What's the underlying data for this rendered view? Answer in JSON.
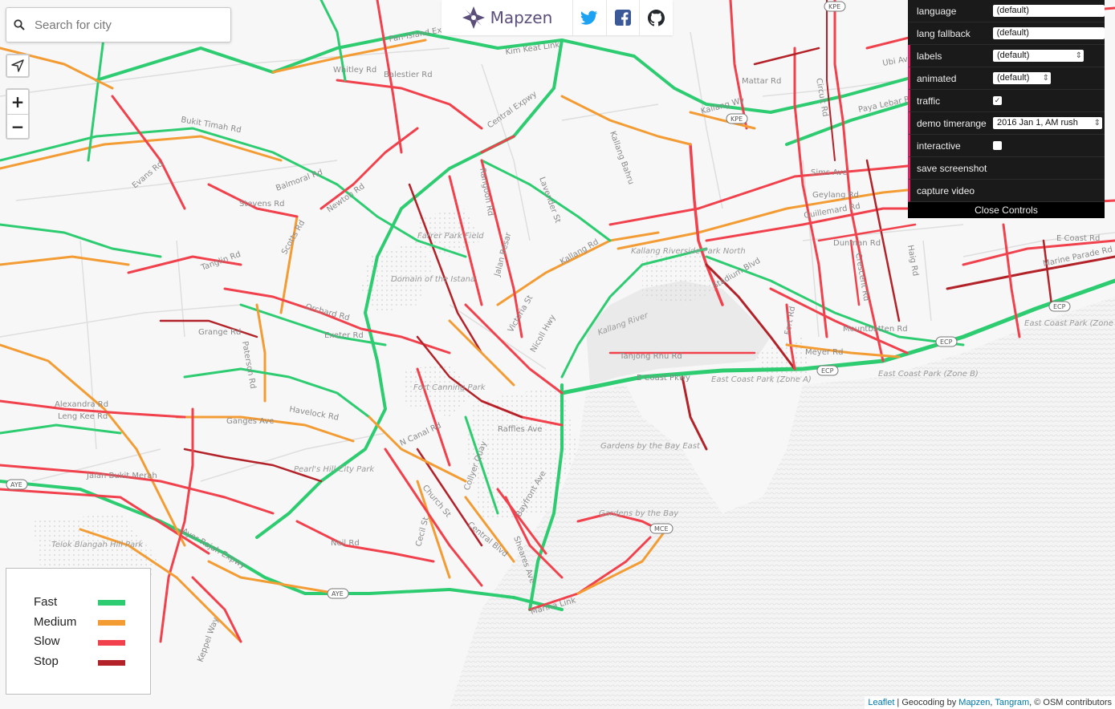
{
  "search": {
    "placeholder": "Search for city"
  },
  "zoom": {
    "in": "+",
    "out": "−"
  },
  "brand": {
    "name": "Mapzen"
  },
  "controls": {
    "language": {
      "label": "language",
      "value": "(default)"
    },
    "lang_fallback": {
      "label": "lang fallback",
      "value": "(default)"
    },
    "labels": {
      "label": "labels",
      "value": "(default)"
    },
    "animated": {
      "label": "animated",
      "value": "(default)"
    },
    "traffic": {
      "label": "traffic",
      "checked": true
    },
    "timerange": {
      "label": "demo timerange",
      "value": "2016 Jan 1, AM rush"
    },
    "interactive": {
      "label": "interactive",
      "checked": false
    },
    "save": "save screenshot",
    "capture": "capture video",
    "close": "Close Controls"
  },
  "legend": {
    "fast": {
      "label": "Fast",
      "color": "#2ecc71"
    },
    "medium": {
      "label": "Medium",
      "color": "#f39c34"
    },
    "slow": {
      "label": "Slow",
      "color": "#f0414c"
    },
    "stop": {
      "label": "Stop",
      "color": "#b22228"
    }
  },
  "map_labels": {
    "pie": "Pan-Island Expwy",
    "kimkeat": "Kim Keat Link",
    "balestier": "Balestier Rd",
    "whitley": "Whitley Rd",
    "bukittimah": "Bukit Timah Rd",
    "cte": "Central Expwy",
    "farrer": "Farrer Park Field",
    "istana": "Domain of the Istana",
    "orchard": "Orchard Rd",
    "fortcanning": "Fort Canning Park",
    "pearl": "Pearl's Hill City Park",
    "havelock": "Havelock Rd",
    "ganges": "Ganges Ave",
    "alexandra": "Alexandra Rd",
    "lengkee": "Leng Kee Rd",
    "jalanmerah": "Jalan Bukit Merah",
    "ayer": "Ayer Rajah Expwy",
    "telok": "Telok Blangah Hill Park",
    "gbtb_east": "Gardens by the Bay East",
    "gbtb": "Gardens by the Bay",
    "ecp": "E Coast Pkwy",
    "ecpark_a": "East Coast Park (Zone A)",
    "ecpark_b": "East Coast Park (Zone B)",
    "ecpark_c": "East Coast Park (Zone C)",
    "kallang_riv": "Kallang Riverside Park North",
    "kallangriver": "Kallang River",
    "tanjong": "Tanjong Rhu Rd",
    "sims": "Sims Ave",
    "geylang": "Geylang Rd",
    "guillemard": "Guillemard Rd",
    "mountbatten": "Mountbatten Rd",
    "meyer": "Meyer Rd",
    "marina": "Marina Link",
    "raffles": "Raffles Ave",
    "paya": "Paya Lebar Rd",
    "stadium": "Stadium Blvd",
    "marineparade": "Marine Parade Rd",
    "dunman": "Dunman Rd",
    "tanglin": "Tanglin Rd",
    "newton": "Newton Rd",
    "scotts": "Scotts Rd",
    "stevens": "Stevens Rd",
    "balmoral": "Balmoral Rd",
    "evans": "Evans Rd",
    "grange": "Grange Rd",
    "kallangbahru": "Kallang Bahru",
    "kallangrd": "Kallang Rd",
    "jalanbesar": "Jalan Besar",
    "rangoon": "Rangoon Rd",
    "lavender": "Lavender St",
    "sheares": "Sheares Ave",
    "centralblvd": "Central Blvd",
    "neil": "Neil Rd",
    "keppel": "Keppel Way",
    "victoria": "Victoria St",
    "nicoll": "Nicoll Hwy",
    "exeter": "Exeter Rd",
    "paterson": "Paterson Rd",
    "cecil": "Cecil St",
    "church": "Church St",
    "collyer": "Collyer Quay",
    "canal": "N Canal Rd",
    "bayfront": "Bayfront Ave",
    "crescent": "Crescent Rd",
    "circuit": "Circuit Rd",
    "mattar": "Mattar Rd",
    "ubi": "Ubi Avenue",
    "fort": "Fort Rd",
    "e_coast_rd": "E Coast Rd",
    "haig": "Haig Rd",
    "kallangwy": "Kallang Wy",
    "aye": "AYE",
    "kpe": "KPE",
    "ecp_shield": "ECP",
    "mce": "MCE"
  },
  "attribution": {
    "leaflet": "Leaflet",
    "mid": " | Geocoding by ",
    "mapzen": "Mapzen",
    "sep": ", ",
    "tangram": "Tangram",
    "osm": ", © OSM contributors"
  }
}
